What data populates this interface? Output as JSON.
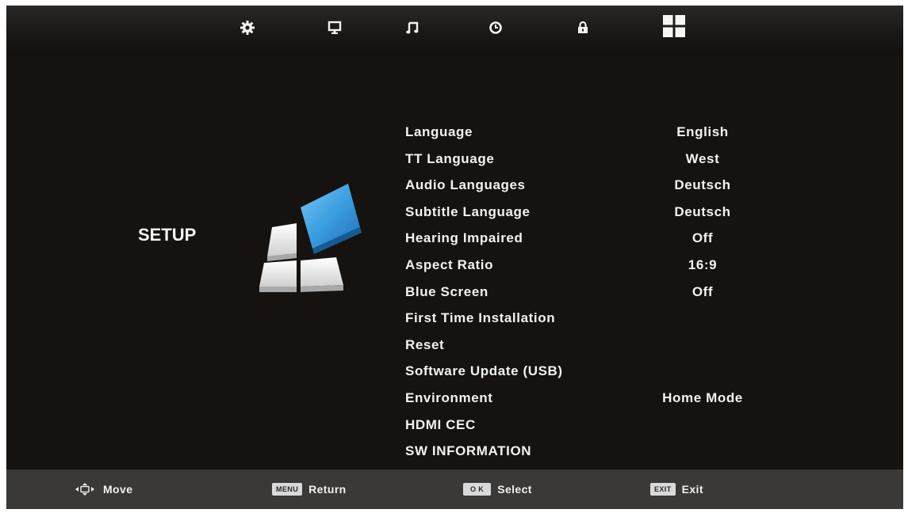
{
  "topbar": {
    "icons": [
      {
        "name": "gear-icon"
      },
      {
        "name": "monitor-icon"
      },
      {
        "name": "music-note-icon"
      },
      {
        "name": "clock-icon"
      },
      {
        "name": "lock-icon"
      },
      {
        "name": "grid-icon"
      }
    ]
  },
  "page": {
    "title": "SETUP"
  },
  "menu": {
    "items": [
      {
        "label": "Language",
        "value": "English"
      },
      {
        "label": "TT Language",
        "value": "West"
      },
      {
        "label": "Audio Languages",
        "value": "Deutsch"
      },
      {
        "label": "Subtitle Language",
        "value": "Deutsch"
      },
      {
        "label": "Hearing Impaired",
        "value": "Off"
      },
      {
        "label": "Aspect Ratio",
        "value": "16:9"
      },
      {
        "label": "Blue Screen",
        "value": "Off"
      },
      {
        "label": "First Time Installation",
        "value": ""
      },
      {
        "label": "Reset",
        "value": ""
      },
      {
        "label": "Software Update (USB)",
        "value": ""
      },
      {
        "label": "Environment",
        "value": "Home Mode"
      },
      {
        "label": "HDMI CEC",
        "value": ""
      },
      {
        "label": "SW INFORMATION",
        "value": ""
      }
    ]
  },
  "footer": {
    "move": {
      "label": "Move"
    },
    "return": {
      "key": "MENU",
      "label": "Return"
    },
    "select": {
      "key": "O K",
      "label": "Select"
    },
    "exit": {
      "key": "EXIT",
      "label": "Exit"
    }
  },
  "colors": {
    "background": "#151210",
    "topbar": "#1f1d1c",
    "bottombar": "#3a3938",
    "text": "#f2f2f2",
    "accent_blue": "#3b9fe0"
  }
}
